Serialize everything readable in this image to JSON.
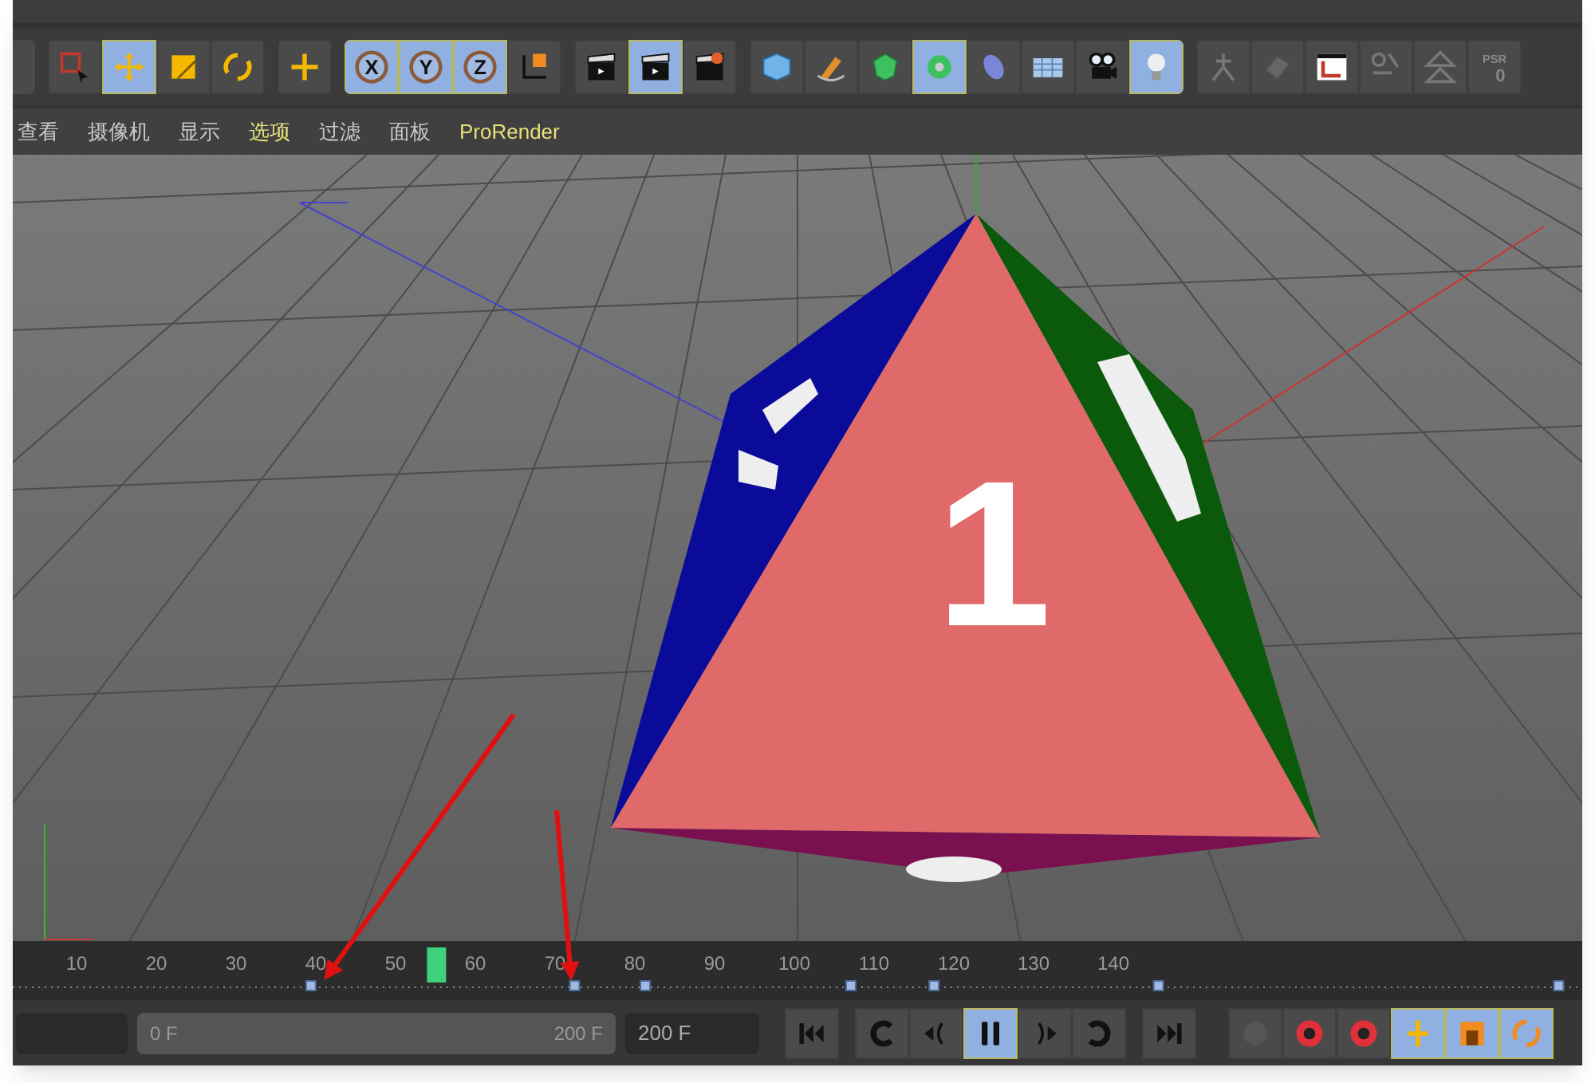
{
  "toolbar": {
    "groups": [
      [
        {
          "kind": "select",
          "selected": false
        },
        {
          "kind": "move",
          "selected": true
        },
        {
          "kind": "scale",
          "selected": false
        },
        {
          "kind": "rotate",
          "selected": false
        }
      ],
      [
        {
          "kind": "add",
          "selected": false
        }
      ],
      [
        {
          "kind": "axis",
          "label": "X",
          "selected": true
        },
        {
          "kind": "axis",
          "label": "Y",
          "selected": true
        },
        {
          "kind": "axis",
          "label": "Z",
          "selected": true
        },
        {
          "kind": "coord",
          "selected": false
        }
      ],
      [
        {
          "kind": "clapper",
          "selected": false
        },
        {
          "kind": "clapper",
          "selected": true
        },
        {
          "kind": "clapper-gear",
          "selected": false
        }
      ],
      [
        {
          "kind": "cube",
          "selected": false
        },
        {
          "kind": "pen",
          "selected": false
        },
        {
          "kind": "gem",
          "selected": false
        },
        {
          "kind": "flower",
          "selected": true
        },
        {
          "kind": "oval",
          "selected": false
        },
        {
          "kind": "floor",
          "selected": false
        },
        {
          "kind": "camera",
          "selected": false
        },
        {
          "kind": "bulb",
          "selected": true
        }
      ],
      [
        {
          "kind": "figure",
          "selected": false
        },
        {
          "kind": "ghost",
          "selected": false
        },
        {
          "kind": "texture",
          "selected": false
        },
        {
          "kind": "xyz",
          "selected": false
        },
        {
          "kind": "triangles",
          "selected": false
        },
        {
          "kind": "psr",
          "label": "PSR",
          "value": "0",
          "selected": false
        }
      ]
    ]
  },
  "viewport_menu": [
    {
      "label": "查看",
      "active": false
    },
    {
      "label": "摄像机",
      "active": false
    },
    {
      "label": "显示",
      "active": false
    },
    {
      "label": "选项",
      "active": true
    },
    {
      "label": "过滤",
      "active": false
    },
    {
      "label": "面板",
      "active": false
    },
    {
      "label": "ProRender",
      "active": true
    }
  ],
  "viewport": {
    "face_label": "1"
  },
  "annotations": [
    {
      "kind": "arrow"
    },
    {
      "kind": "arrow"
    }
  ],
  "timeline": {
    "ticks": [
      "10",
      "20",
      "30",
      "40",
      "50",
      "60",
      "70",
      "80",
      "90",
      "100",
      "110",
      "120",
      "130",
      "140"
    ],
    "playhead": {
      "level": 0.27
    },
    "keyframes": [
      {
        "level": 0.19
      },
      {
        "level": 0.358
      },
      {
        "level": 0.403
      },
      {
        "level": 0.534
      },
      {
        "level": 0.587
      },
      {
        "level": 0.73
      },
      {
        "level": 0.985
      }
    ]
  },
  "controls": {
    "range_slider": {
      "start": "0 F",
      "end": "200 F",
      "level": 1
    },
    "end_field": {
      "value": "200 F"
    },
    "transport": [
      {
        "kind": "first",
        "selected": false
      },
      {
        "kind": "prev-key",
        "selected": false
      },
      {
        "kind": "prev-frame",
        "selected": false
      },
      {
        "kind": "pause",
        "selected": true
      },
      {
        "kind": "next-frame",
        "selected": false
      },
      {
        "kind": "next-key",
        "selected": false
      },
      {
        "kind": "last",
        "selected": false
      }
    ],
    "record": [
      {
        "kind": "record-dot",
        "selected": false
      },
      {
        "kind": "record",
        "selected": false
      },
      {
        "kind": "record",
        "selected": false
      },
      {
        "kind": "move-key",
        "selected": true
      },
      {
        "kind": "scale-key",
        "selected": true
      },
      {
        "kind": "rotate-key",
        "selected": true
      }
    ]
  }
}
